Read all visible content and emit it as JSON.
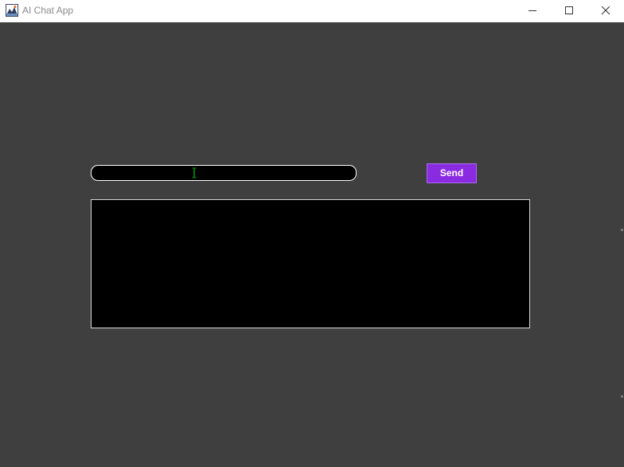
{
  "window": {
    "title": "AI Chat App",
    "background_color": "#3f3f3f",
    "titlebar_color": "#ffffff",
    "icons": {
      "app": "app-icon",
      "minimize": "minimize-icon",
      "maximize": "maximize-icon",
      "close": "close-icon"
    }
  },
  "input": {
    "value": "",
    "placeholder": "",
    "background_color": "#000000",
    "border_color": "#ffffff",
    "caret_color": "#00a000"
  },
  "send_button": {
    "label": "Send",
    "color": "#8a2be2",
    "text_color": "#ffffff"
  },
  "chat_area": {
    "content": "",
    "background_color": "#000000",
    "border_color": "#d6d6d6"
  }
}
